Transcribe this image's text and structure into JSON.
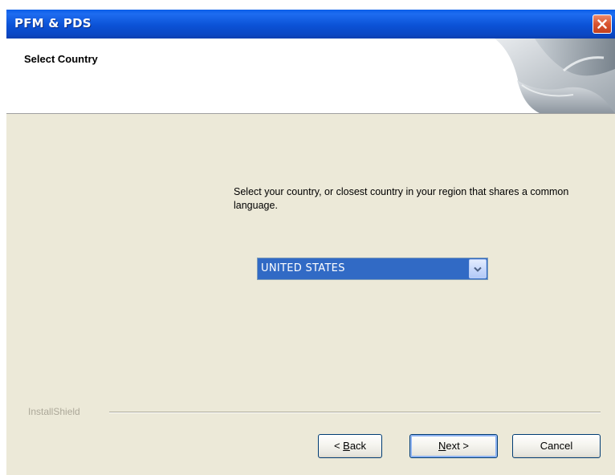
{
  "window": {
    "title": "PFM & PDS"
  },
  "banner": {
    "title": "Select Country"
  },
  "content": {
    "instruction": "Select your country, or closest country in your region that shares a common language.",
    "country_select": {
      "selected": "UNITED STATES"
    }
  },
  "footer": {
    "brand": "InstallShield",
    "buttons": {
      "back": {
        "prefix": "< ",
        "mnemonic": "B",
        "rest": "ack"
      },
      "next": {
        "mnemonic": "N",
        "rest": "ext >"
      },
      "cancel": "Cancel"
    }
  },
  "colors": {
    "titlebar": "#0a52d6",
    "dialog_background": "#ece9d8",
    "selection": "#316ac5",
    "close_button": "#d9542f"
  },
  "icons": {
    "close": "close-icon",
    "dropdown": "chevron-down-icon",
    "banner": "banner-art"
  }
}
